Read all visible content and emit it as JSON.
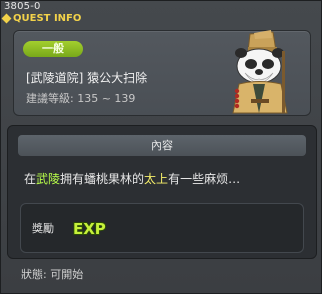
{
  "window": {
    "quest_id": "3805-0",
    "title": "QUEST INFO"
  },
  "quest": {
    "level_badge": "一般",
    "name": "[武陵道院] 猿公大扫除",
    "level_requirement": "建議等級: 135 ~ 139"
  },
  "content": {
    "header": "內容",
    "text_before": "在",
    "place": "武陵",
    "text_middle": "拥有蟠桃果林的",
    "person": "太上",
    "text_after": "有一些麻烦…"
  },
  "reward": {
    "label": "獎勵",
    "exp_icon_text": "EXP"
  },
  "status": {
    "text": "狀態:  可開始"
  },
  "colors": {
    "title_yellow": "#f2d24a",
    "badge_green": "#8fc026",
    "place_highlight": "#b9ff4a",
    "person_highlight": "#f6ef6a"
  },
  "icons": {
    "title": "quest-book-icon",
    "npc": "panda-npc-portrait",
    "reward": "exp-icon"
  }
}
